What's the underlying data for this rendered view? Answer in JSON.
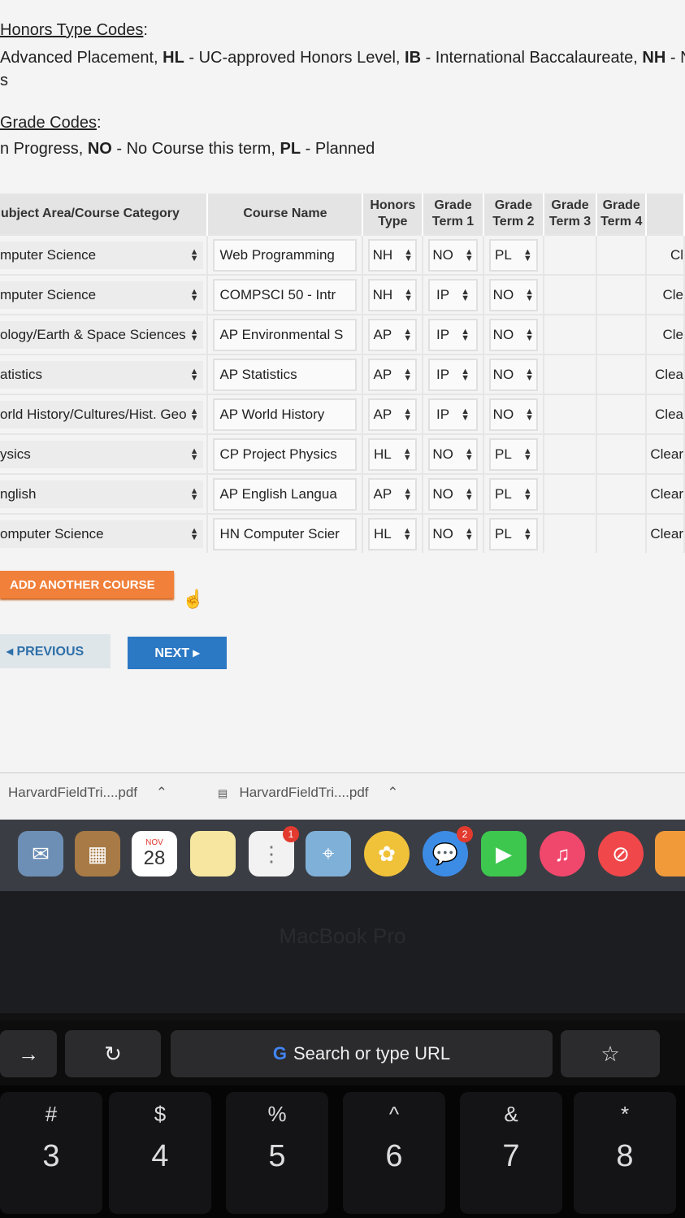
{
  "codes": {
    "honors_title": "Honors Type Codes",
    "honors_line_a": "Advanced Placement, ",
    "honors_hl": "HL",
    "honors_line_b": " - UC-approved Honors Level, ",
    "honors_ib": "IB",
    "honors_line_c": " - International Baccalaureate, ",
    "honors_nh": "NH",
    "honors_line_d": " - Not",
    "honors_line_wrap": "s",
    "grade_title": "Grade Codes",
    "grade_line_a": "n Progress, ",
    "grade_no": "NO",
    "grade_line_b": " - No Course this term, ",
    "grade_pl": "PL",
    "grade_line_c": " - Planned"
  },
  "table": {
    "headers": {
      "category": "ubject Area/Course Category",
      "course": "Course Name",
      "honors1": "Honors",
      "honors2": "Type",
      "t1a": "Grade",
      "t1b": "Term 1",
      "t2a": "Grade",
      "t2b": "Term 2",
      "t3a": "Grade",
      "t3b": "Term 3",
      "t4a": "Grade",
      "t4b": "Term 4"
    },
    "rows": [
      {
        "category": "mputer Science",
        "course": "Web Programming",
        "honors": "NH",
        "term1": "NO",
        "term2": "PL",
        "clear": "Cl"
      },
      {
        "category": "mputer Science",
        "course": "COMPSCI 50 - Intr",
        "honors": "NH",
        "term1": "IP",
        "term2": "NO",
        "clear": "Cle"
      },
      {
        "category": "ology/Earth & Space Sciences",
        "course": "AP Environmental S",
        "honors": "AP",
        "term1": "IP",
        "term2": "NO",
        "clear": "Cle"
      },
      {
        "category": "atistics",
        "course": "AP Statistics",
        "honors": "AP",
        "term1": "IP",
        "term2": "NO",
        "clear": "Clea"
      },
      {
        "category": "orld History/Cultures/Hist. Geo",
        "course": "AP World History",
        "honors": "AP",
        "term1": "IP",
        "term2": "NO",
        "clear": "Clea"
      },
      {
        "category": "ysics",
        "course": "CP Project Physics",
        "honors": "HL",
        "term1": "NO",
        "term2": "PL",
        "clear": "Clear"
      },
      {
        "category": "nglish",
        "course": "AP English Langua",
        "honors": "AP",
        "term1": "NO",
        "term2": "PL",
        "clear": "Clear"
      },
      {
        "category": "omputer Science",
        "course": "HN Computer Scier",
        "honors": "HL",
        "term1": "NO",
        "term2": "PL",
        "clear": "Clear"
      }
    ]
  },
  "buttons": {
    "add": "ADD ANOTHER COURSE",
    "previous": "PREVIOUS",
    "next": "NEXT"
  },
  "downloads": [
    "HarvardFieldTri....pdf",
    "HarvardFieldTri....pdf"
  ],
  "dock": {
    "calendar_month": "NOV",
    "calendar_day": "28",
    "reminders_badge": "1",
    "messages_badge": "2"
  },
  "laptop_brand": "MacBook Pro",
  "touchbar": {
    "search_placeholder": "Search or type URL"
  },
  "keys": [
    {
      "shift": "#",
      "main": "3"
    },
    {
      "shift": "$",
      "main": "4"
    },
    {
      "shift": "%",
      "main": "5"
    },
    {
      "shift": "^",
      "main": "6"
    },
    {
      "shift": "&",
      "main": "7"
    },
    {
      "shift": "*",
      "main": "8"
    }
  ]
}
